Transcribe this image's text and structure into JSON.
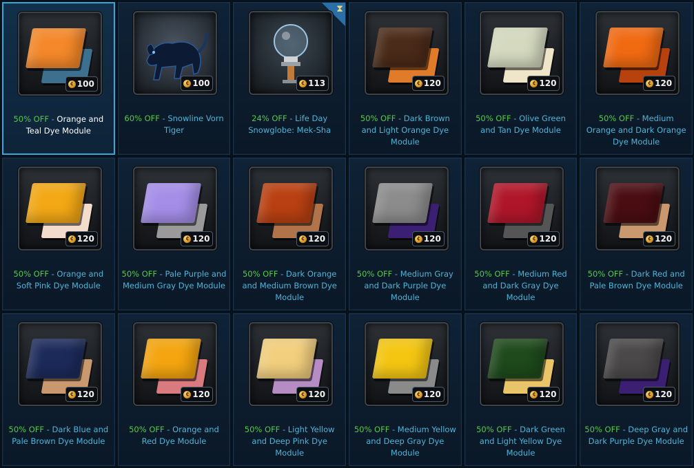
{
  "currency_icon": "cartel-coin-icon",
  "items": [
    {
      "sale": "50% OFF",
      "name": "Orange and Teal Dye Module",
      "price": "100",
      "primary": "#f4882a",
      "secondary": "#3d6f8e",
      "icon": "dye-module-icon",
      "selected": true,
      "name_color": "#ffffff"
    },
    {
      "sale": "60% OFF",
      "name": "Snowline Vorn Tiger",
      "price": "100",
      "icon": "vorn-tiger-icon"
    },
    {
      "sale": "24% OFF",
      "name": "Life Day Snowglobe: Mek-Sha",
      "price": "113",
      "icon": "snowglobe-icon",
      "timed": true,
      "timer_icon": "hourglass-icon"
    },
    {
      "sale": "50% OFF",
      "name": "Dark Brown and Light Orange Dye Module",
      "price": "120",
      "primary": "#4a2a18",
      "secondary": "#e07b2a",
      "icon": "dye-module-icon"
    },
    {
      "sale": "50% OFF",
      "name": "Olive Green and Tan Dye Module",
      "price": "120",
      "primary": "#d4d9bf",
      "secondary": "#efe6c9",
      "icon": "dye-module-icon"
    },
    {
      "sale": "50% OFF",
      "name": "Medium Orange and Dark Orange Dye Module",
      "price": "120",
      "primary": "#f06a12",
      "secondary": "#b8420e",
      "icon": "dye-module-icon"
    },
    {
      "sale": "50% OFF",
      "name": "Orange and Soft Pink Dye Module",
      "price": "120",
      "primary": "#f3a815",
      "secondary": "#f3dccb",
      "icon": "dye-module-icon"
    },
    {
      "sale": "50% OFF",
      "name": "Pale Purple and Medium Gray Dye Module",
      "price": "120",
      "primary": "#a48ee8",
      "secondary": "#9a9a9a",
      "icon": "dye-module-icon"
    },
    {
      "sale": "50% OFF",
      "name": "Dark Orange and Medium Brown Dye Module",
      "price": "120",
      "primary": "#b94012",
      "secondary": "#b0734a",
      "icon": "dye-module-icon"
    },
    {
      "sale": "50% OFF",
      "name": "Medium Gray and Dark Purple Dye Module",
      "price": "120",
      "primary": "#8c8c8c",
      "secondary": "#3a1f72",
      "icon": "dye-module-icon"
    },
    {
      "sale": "50% OFF",
      "name": "Medium Red and Dark Gray Dye Module",
      "price": "120",
      "primary": "#b0162a",
      "secondary": "#555555",
      "icon": "dye-module-icon"
    },
    {
      "sale": "50% OFF",
      "name": "Dark Red and Pale Brown Dye Module",
      "price": "120",
      "primary": "#4a0d12",
      "secondary": "#c9986e",
      "icon": "dye-module-icon"
    },
    {
      "sale": "50% OFF",
      "name": "Dark Blue and Pale Brown Dye Module",
      "price": "120",
      "primary": "#1c2a5a",
      "secondary": "#c9986e",
      "icon": "dye-module-icon"
    },
    {
      "sale": "50% OFF",
      "name": "Orange and Red Dye Module",
      "price": "120",
      "primary": "#f4a510",
      "secondary": "#d87a7e",
      "icon": "dye-module-icon"
    },
    {
      "sale": "50% OFF",
      "name": "Light Yellow and Deep Pink Dye Module",
      "price": "120",
      "primary": "#f2cf7e",
      "secondary": "#b68cc4",
      "icon": "dye-module-icon"
    },
    {
      "sale": "50% OFF",
      "name": "Medium Yellow and Deep Gray Dye Module",
      "price": "120",
      "primary": "#f4c612",
      "secondary": "#8a8a8a",
      "icon": "dye-module-icon"
    },
    {
      "sale": "50% OFF",
      "name": "Dark Green and Light Yellow Dye Module",
      "price": "120",
      "primary": "#1e4a1c",
      "secondary": "#e9c56a",
      "icon": "dye-module-icon"
    },
    {
      "sale": "50% OFF",
      "name": "Deep Gray and Dark Purple Dye Module",
      "price": "120",
      "primary": "#4a4848",
      "secondary": "#3a1f72",
      "icon": "dye-module-icon"
    }
  ]
}
